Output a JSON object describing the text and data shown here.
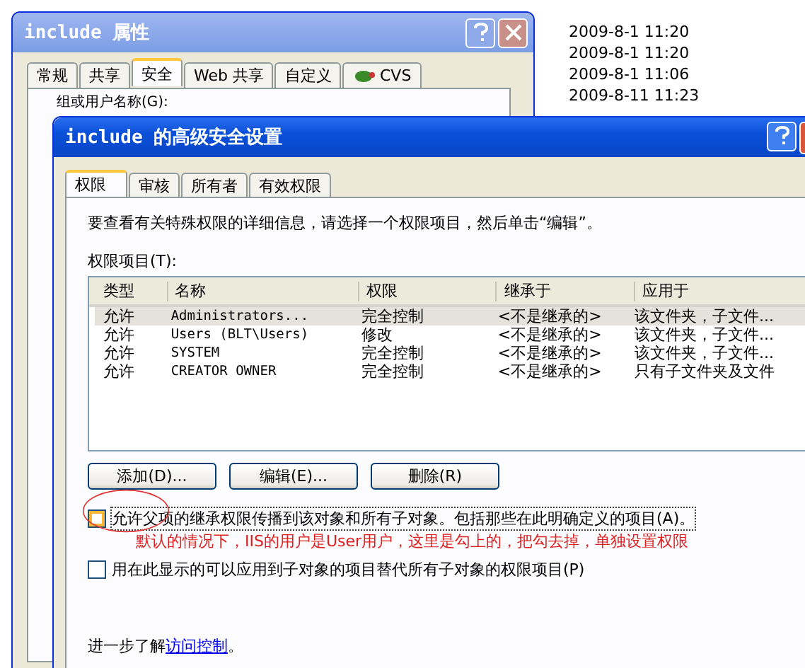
{
  "background_list": {
    "dates": [
      "2009-8-1 11:20",
      "2009-8-1 11:20",
      "2009-8-1 11:06",
      "2009-8-11 11:23"
    ]
  },
  "properties_window": {
    "title": "include 属性",
    "tabs": [
      {
        "label": "常规",
        "selected": false,
        "icon": false
      },
      {
        "label": "共享",
        "selected": false,
        "icon": false
      },
      {
        "label": "安全",
        "selected": true,
        "icon": false
      },
      {
        "label": "Web 共享",
        "selected": false,
        "icon": false
      },
      {
        "label": "自定义",
        "selected": false,
        "icon": false
      },
      {
        "label": "CVS",
        "selected": false,
        "icon": true
      }
    ],
    "group_label": "组或用户名称(G):"
  },
  "dialog": {
    "title": "include 的高级安全设置",
    "tabs": [
      {
        "label": "权限",
        "selected": true
      },
      {
        "label": "审核",
        "selected": false
      },
      {
        "label": "所有者",
        "selected": false
      },
      {
        "label": "有效权限",
        "selected": false
      }
    ],
    "instruction": "要查看有关特殊权限的详细信息，请选择一个权限项目，然后单击“编辑”。",
    "list_label": "权限项目(T):",
    "table": {
      "columns": [
        "类型",
        "名称",
        "权限",
        "继承于",
        "应用于"
      ],
      "rows": [
        {
          "cells": [
            "允许",
            "Administrators...",
            "完全控制",
            "<不是继承的>",
            "该文件夹，子文件..."
          ],
          "selected": true
        },
        {
          "cells": [
            "允许",
            "Users (BLT\\Users)",
            "修改",
            "<不是继承的>",
            "该文件夹，子文件..."
          ],
          "selected": false
        },
        {
          "cells": [
            "允许",
            "SYSTEM",
            "完全控制",
            "<不是继承的>",
            "该文件夹，子文件..."
          ],
          "selected": false
        },
        {
          "cells": [
            "允许",
            "CREATOR OWNER",
            "完全控制",
            "<不是继承的>",
            "只有子文件夹及文件"
          ],
          "selected": false
        }
      ]
    },
    "buttons": [
      "添加(D)...",
      "编辑(E)...",
      "删除(R)"
    ],
    "options": [
      {
        "label": "允许父项的继承权限传播到该对象和所有子对象。包括那些在此明确定义的项目(A)。",
        "checked": false,
        "focused": true,
        "annotation": "默认的情况下，IIS的用户是User用户，这里是勾上的，把勾去掉，单独设置权限"
      },
      {
        "label": "用在此显示的可以应用到子对象的项目替代所有子对象的权限项目(P)",
        "checked": false,
        "focused": false
      }
    ],
    "footer": {
      "text": "进一步了解",
      "link": "访问控制",
      "end": "。"
    }
  }
}
